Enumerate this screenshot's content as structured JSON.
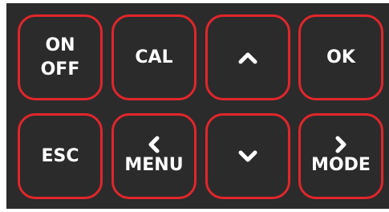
{
  "keypad": {
    "row1": {
      "onoff": {
        "line1": "ON",
        "line2": "OFF"
      },
      "cal": "CAL",
      "up_icon": "chevron-up-icon",
      "ok": "OK"
    },
    "row2": {
      "esc": "ESC",
      "menu": {
        "icon": "chevron-left-icon",
        "label": "MENU"
      },
      "down_icon": "chevron-down-icon",
      "mode": {
        "icon": "chevron-right-icon",
        "label": "MODE"
      }
    }
  },
  "colors": {
    "panel_background": "#2b2b2b",
    "key_border": "#e0262b",
    "key_text": "#ffffff"
  }
}
